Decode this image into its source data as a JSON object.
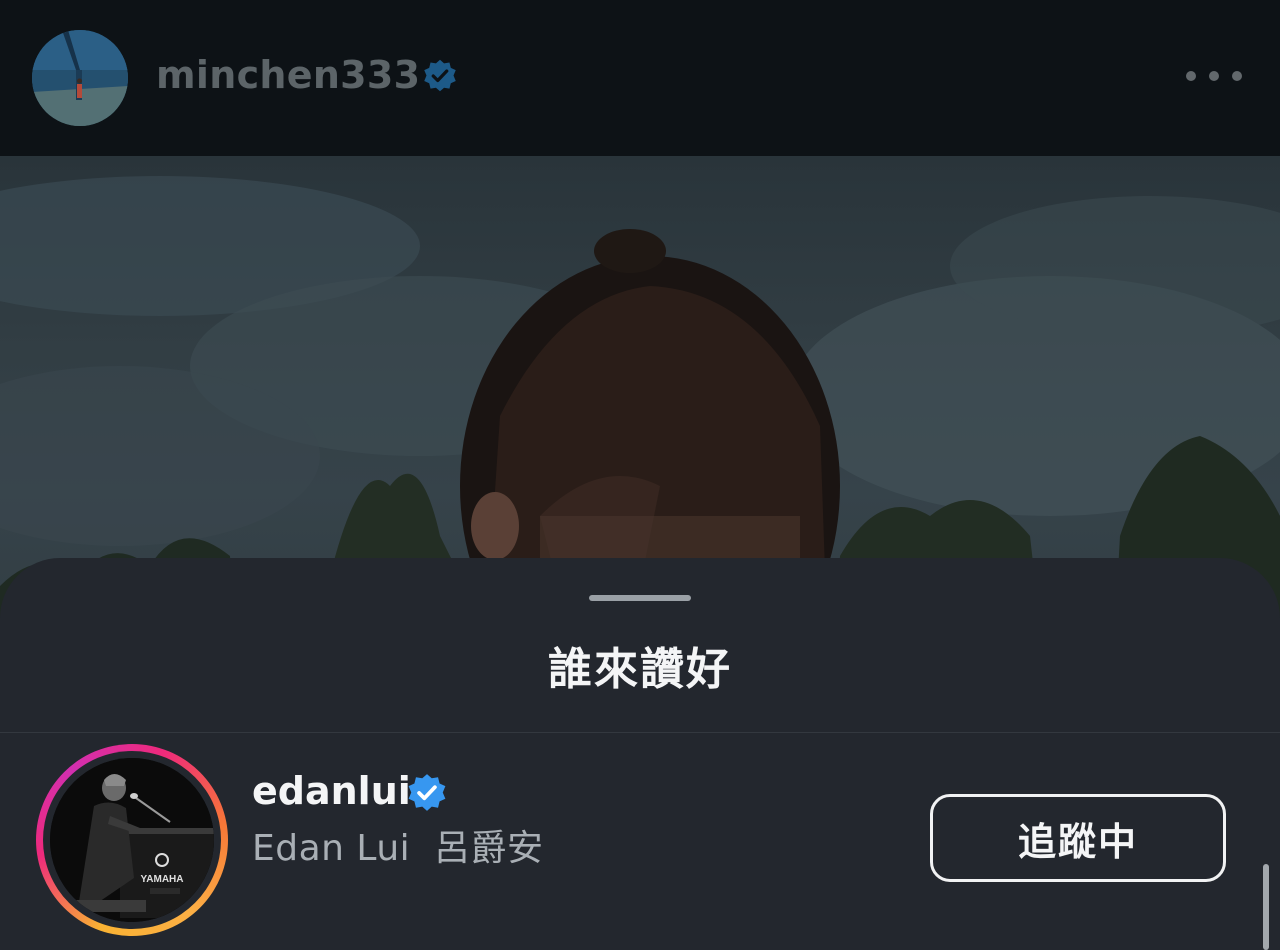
{
  "post": {
    "username": "minchen333",
    "verified_icon": "verified-badge-icon",
    "more_icon": "more-options-icon",
    "photo_icon": "post-photo"
  },
  "likes_sheet": {
    "title": "誰來讚好",
    "likers": [
      {
        "username": "edanlui",
        "verified": true,
        "full_name": "Edan Lui  呂爵安",
        "follow_state": "追蹤中",
        "has_story_ring": true
      }
    ]
  },
  "colors": {
    "sheet_background": "#23272e",
    "verified_blue": "#3797f0",
    "dimmed_header": "#0d1216"
  }
}
